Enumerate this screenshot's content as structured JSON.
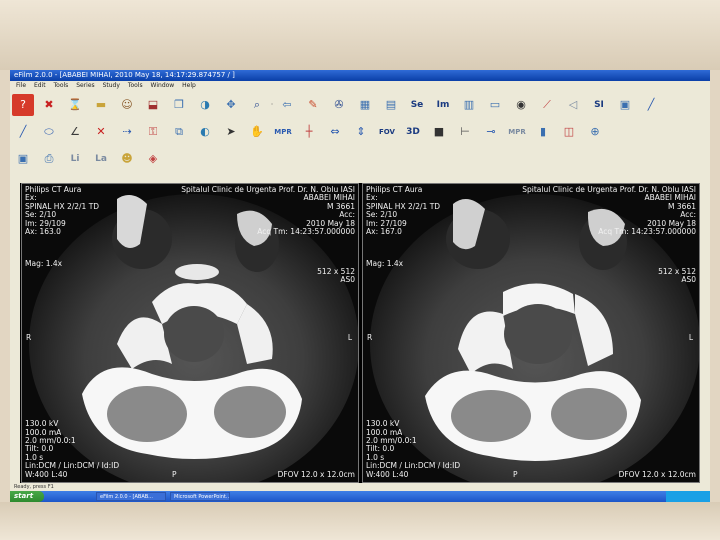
{
  "window": {
    "title": "eFilm 2.0.0 - [ABABEI MIHAI, 2010 May 18, 14:17:29.874757 / ]"
  },
  "menu": [
    "File",
    "Edit",
    "Tools",
    "Series",
    "Study",
    "Tools",
    "Window",
    "Help"
  ],
  "toolbar": {
    "labels": {
      "se": "Se",
      "im": "Im",
      "mpr": "MPR",
      "fov": "FOV",
      "threed": "3D",
      "li": "Li",
      "la": "La",
      "si": "SI"
    }
  },
  "panes": [
    {
      "top_left": [
        "Philips CT Aura",
        "Ex:",
        "SPINAL HX 2/2/1 TD",
        "Se: 2/10",
        "Im: 29/109",
        "Ax: 163.0"
      ],
      "top_right": [
        "Spitalul Clinic de Urgenta Prof. Dr. N. Oblu IASI",
        "ABABEI MIHAI",
        "M 3661",
        "Acc:",
        "2010 May 18",
        "Acq Tm: 14:23:57.000000"
      ],
      "mag": "Mag: 1.4x",
      "size": [
        "512 x 512",
        "AS0"
      ],
      "side_r": "R",
      "side_l": "L",
      "bottom_left": [
        "130.0 kV",
        "100.0 mA",
        "2.0 mm/0.0:1",
        "Tilt: 0.0",
        "1.0 s",
        "Lin:DCM / Lin:DCM / Id:ID",
        "W:400 L:40"
      ],
      "bottom_center": "P",
      "bottom_right": "DFOV 12.0 x 12.0cm"
    },
    {
      "top_left": [
        "Philips CT Aura",
        "Ex:",
        "SPINAL HX 2/2/1 TD",
        "Se: 2/10",
        "Im: 27/109",
        "Ax: 167.0"
      ],
      "top_right": [
        "Spitalul Clinic de Urgenta Prof. Dr. N. Oblu IASI",
        "ABABEI MIHAI",
        "M 3661",
        "Acc:",
        "2010 May 18",
        "Acq Tm: 14:23:57.000000"
      ],
      "mag": "Mag: 1.4x",
      "size": [
        "512 x 512",
        "AS0"
      ],
      "side_r": "R",
      "side_l": "L",
      "bottom_left": [
        "130.0 kV",
        "100.0 mA",
        "2.0 mm/0.0:1",
        "Tilt: 0.0",
        "1.0 s",
        "Lin:DCM / Lin:DCM / Id:ID",
        "W:400 L:40"
      ],
      "bottom_center": "P",
      "bottom_right": "DFOV 12.0 x 12.0cm"
    }
  ],
  "status": "Ready, press F1",
  "taskbar": {
    "start": "start",
    "tasks": [
      "eFilm 2.0.0 - [ABAB...",
      "Microsoft PowerPoint..."
    ]
  }
}
